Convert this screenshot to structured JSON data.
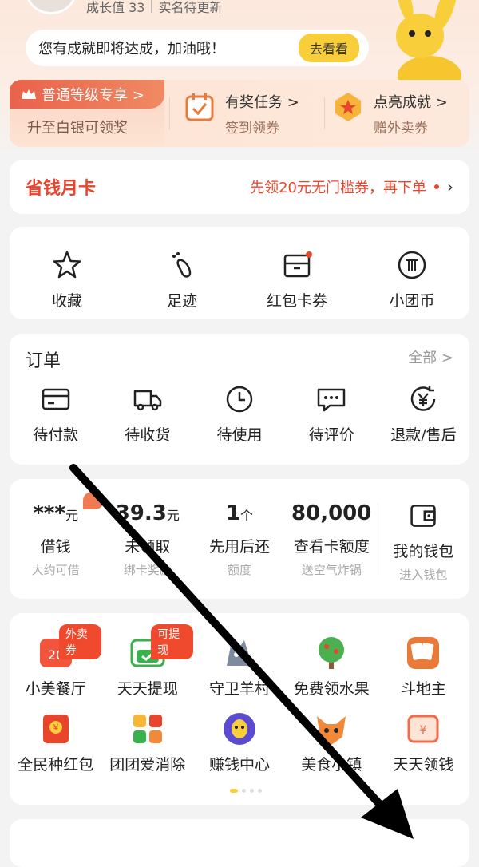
{
  "profile": {
    "growth_value": "成长值 33",
    "realname_status": "实名待更新"
  },
  "achievement": {
    "text": "您有成就即将达成，加油哦！",
    "button": "去看看"
  },
  "promo": {
    "level_tag": "普通等级专享 >",
    "level_sub": "升至白银可领奖",
    "task_title": "有奖任务 >",
    "task_sub": "签到领券",
    "achieve_title": "点亮成就 >",
    "achieve_sub": "赠外卖券"
  },
  "saving_card": {
    "title": "省钱月卡",
    "desc": "先领20元无门槛券，再下单"
  },
  "quick_links": [
    {
      "label": "收藏",
      "icon": "star-icon"
    },
    {
      "label": "足迹",
      "icon": "footprint-icon"
    },
    {
      "label": "红包卡券",
      "icon": "wallet-card-icon"
    },
    {
      "label": "小团币",
      "icon": "coin-icon"
    }
  ],
  "orders": {
    "title": "订单",
    "all": "全部 >",
    "items": [
      {
        "label": "待付款",
        "icon": "card-icon"
      },
      {
        "label": "待收货",
        "icon": "truck-icon"
      },
      {
        "label": "待使用",
        "icon": "clock-icon"
      },
      {
        "label": "待评价",
        "icon": "chat-icon"
      },
      {
        "label": "退款/售后",
        "icon": "yuan-refund-icon"
      }
    ]
  },
  "finance": [
    {
      "value": "***",
      "unit": "元",
      "label": "借钱",
      "sub": "大约可借"
    },
    {
      "value": "39.3",
      "unit": "元",
      "label": "未领取",
      "sub": "绑卡奖励"
    },
    {
      "value": "1",
      "unit": "个",
      "label": "先用后还",
      "sub": "额度"
    },
    {
      "value": "80,000",
      "unit": "",
      "label": "查看卡额度",
      "sub": "送空气炸锅"
    },
    {
      "value": "",
      "unit": "",
      "label": "我的钱包",
      "sub": "进入钱包"
    }
  ],
  "games": {
    "row1": [
      {
        "label": "小美餐厅",
        "badge": "外卖券",
        "color": "#f2553b"
      },
      {
        "label": "天天提现",
        "badge": "可提现",
        "color": "#37b24d"
      },
      {
        "label": "守卫羊村",
        "badge": "",
        "color": "#7d8aa0"
      },
      {
        "label": "免费领水果",
        "badge": "",
        "color": "#4caf50"
      },
      {
        "label": "斗地主",
        "badge": "",
        "color": "#e97a3a"
      }
    ],
    "row2": [
      {
        "label": "全民种红包",
        "badge": "",
        "color": "#e9442c"
      },
      {
        "label": "团团爱消除",
        "badge": "",
        "color": "#f7b733"
      },
      {
        "label": "赚钱中心",
        "badge": "",
        "color": "#5a4bd1"
      },
      {
        "label": "美食小镇",
        "badge": "",
        "color": "#f08a3a"
      },
      {
        "label": "天天领钱",
        "badge": "",
        "color": "#f26b4a"
      }
    ]
  },
  "colors": {
    "accent": "#f8cf3a",
    "red": "#e9442c"
  }
}
